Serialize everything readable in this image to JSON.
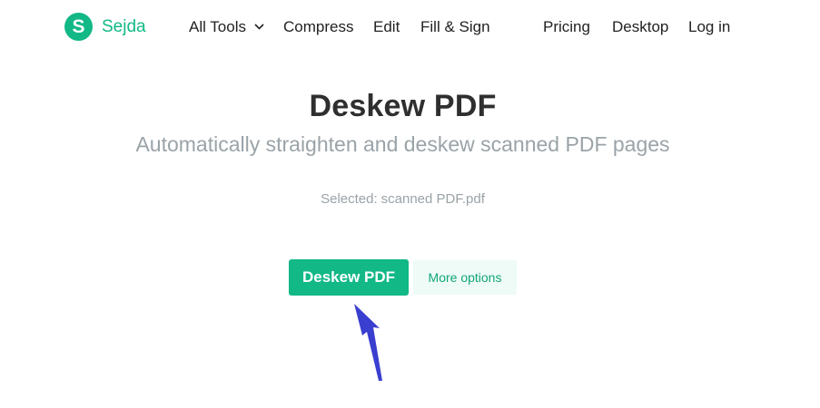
{
  "header": {
    "logo": {
      "mark": "S",
      "text": "Sejda"
    },
    "nav": {
      "all_tools": "All Tools",
      "compress": "Compress",
      "edit": "Edit",
      "fill_sign": "Fill & Sign",
      "pricing": "Pricing",
      "desktop": "Desktop",
      "login": "Log in"
    }
  },
  "main": {
    "title": "Deskew PDF",
    "subtitle": "Automatically straighten and deskew scanned PDF pages",
    "selected_label": "Selected:",
    "selected_file": "scanned PDF.pdf",
    "primary_button": "Deskew PDF",
    "secondary_button": "More options"
  },
  "annotation": {
    "arrow_color": "#3b3fcf"
  },
  "colors": {
    "brand": "#12b886",
    "secondary_bg": "#eefbf6",
    "muted_text": "#9aa3a8"
  }
}
